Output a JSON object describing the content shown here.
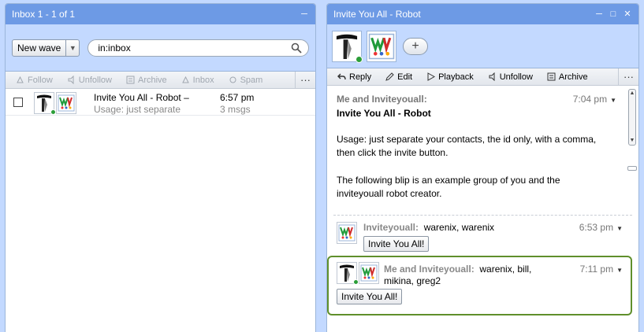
{
  "inbox": {
    "title": "Inbox 1 - 1 of 1",
    "new_wave_label": "New wave",
    "search_value": "in:inbox",
    "toolbar": [
      "Follow",
      "Unfollow",
      "Archive",
      "Inbox",
      "Spam"
    ],
    "more": "···",
    "waves": [
      {
        "title": "Invite You All - Robot –",
        "snippet": "Usage: just separate",
        "time": "6:57 pm",
        "count": "3 msgs"
      }
    ]
  },
  "wave": {
    "title": "Invite You All - Robot",
    "add_label": "+",
    "toolbar": [
      "Reply",
      "Edit",
      "Playback",
      "Unfollow",
      "Archive"
    ],
    "more": "···",
    "root": {
      "author": "Me and Inviteyouall:",
      "time": "7:04 pm",
      "title": "Invite You All - Robot",
      "para1": "Usage: just separate your contacts, the id only,  with a comma, then click the invite button.",
      "para2": "The following blip is an example group of you and the inviteyouall robot creator."
    },
    "reply1": {
      "author": "Inviteyouall:",
      "text": "warenix, warenix",
      "time": "6:53 pm",
      "button": "Invite You All!"
    },
    "reply2": {
      "author": "Me and Inviteyouall:",
      "text": "warenix, bill,",
      "text2": "mikina, greg2",
      "time": "7:11 pm",
      "button": "Invite You All!"
    }
  },
  "colors": {
    "titlebar": "#6d9ae5",
    "online": "#2b9e38",
    "active_border": "#5f8f2b"
  }
}
